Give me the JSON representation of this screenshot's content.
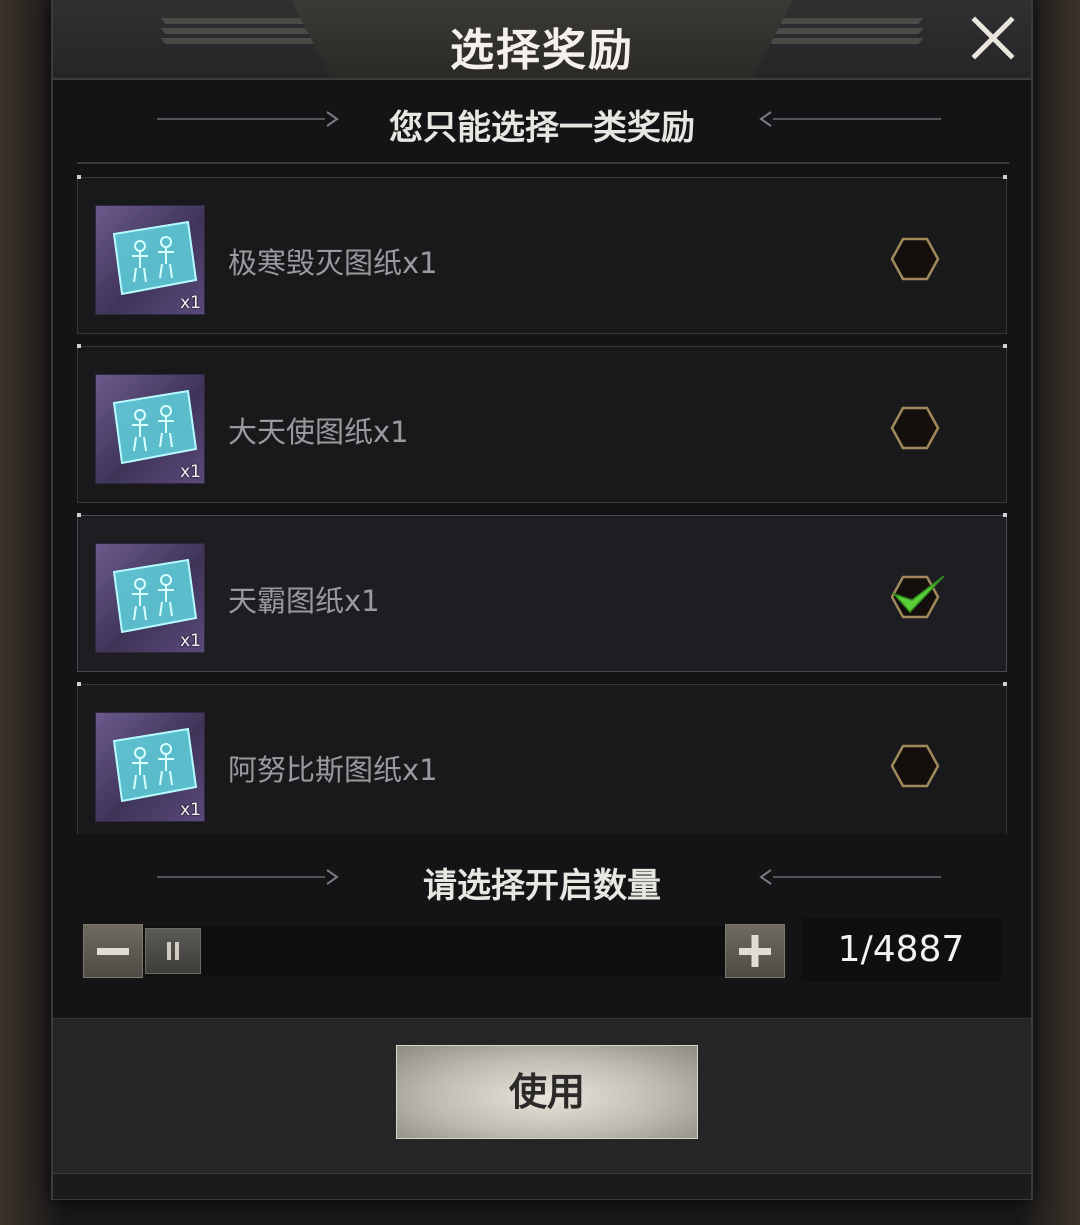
{
  "dialog": {
    "title": "选择奖励",
    "close_icon": "close-x-icon"
  },
  "reward_section": {
    "heading": "您只能选择一类奖励",
    "items": [
      {
        "label": "极寒毁灭图纸x1",
        "badge": "x1",
        "icon": "blueprint-icon",
        "selected": false
      },
      {
        "label": "大天使图纸x1",
        "badge": "x1",
        "icon": "blueprint-icon",
        "selected": false
      },
      {
        "label": "天霸图纸x1",
        "badge": "x1",
        "icon": "blueprint-icon",
        "selected": true
      },
      {
        "label": "阿努比斯图纸x1",
        "badge": "x1",
        "icon": "blueprint-icon",
        "selected": false
      }
    ]
  },
  "quantity_section": {
    "heading": "请选择开启数量",
    "count_display": "1/4887",
    "current": 1,
    "max": 4887,
    "minus_icon": "minus-icon",
    "plus_icon": "plus-icon"
  },
  "footer": {
    "use_label": "使用"
  },
  "colors": {
    "check_green": "#5ad13a",
    "hex_border": "#a08a5c",
    "blueprint_cyan": "#6fe3ea"
  }
}
